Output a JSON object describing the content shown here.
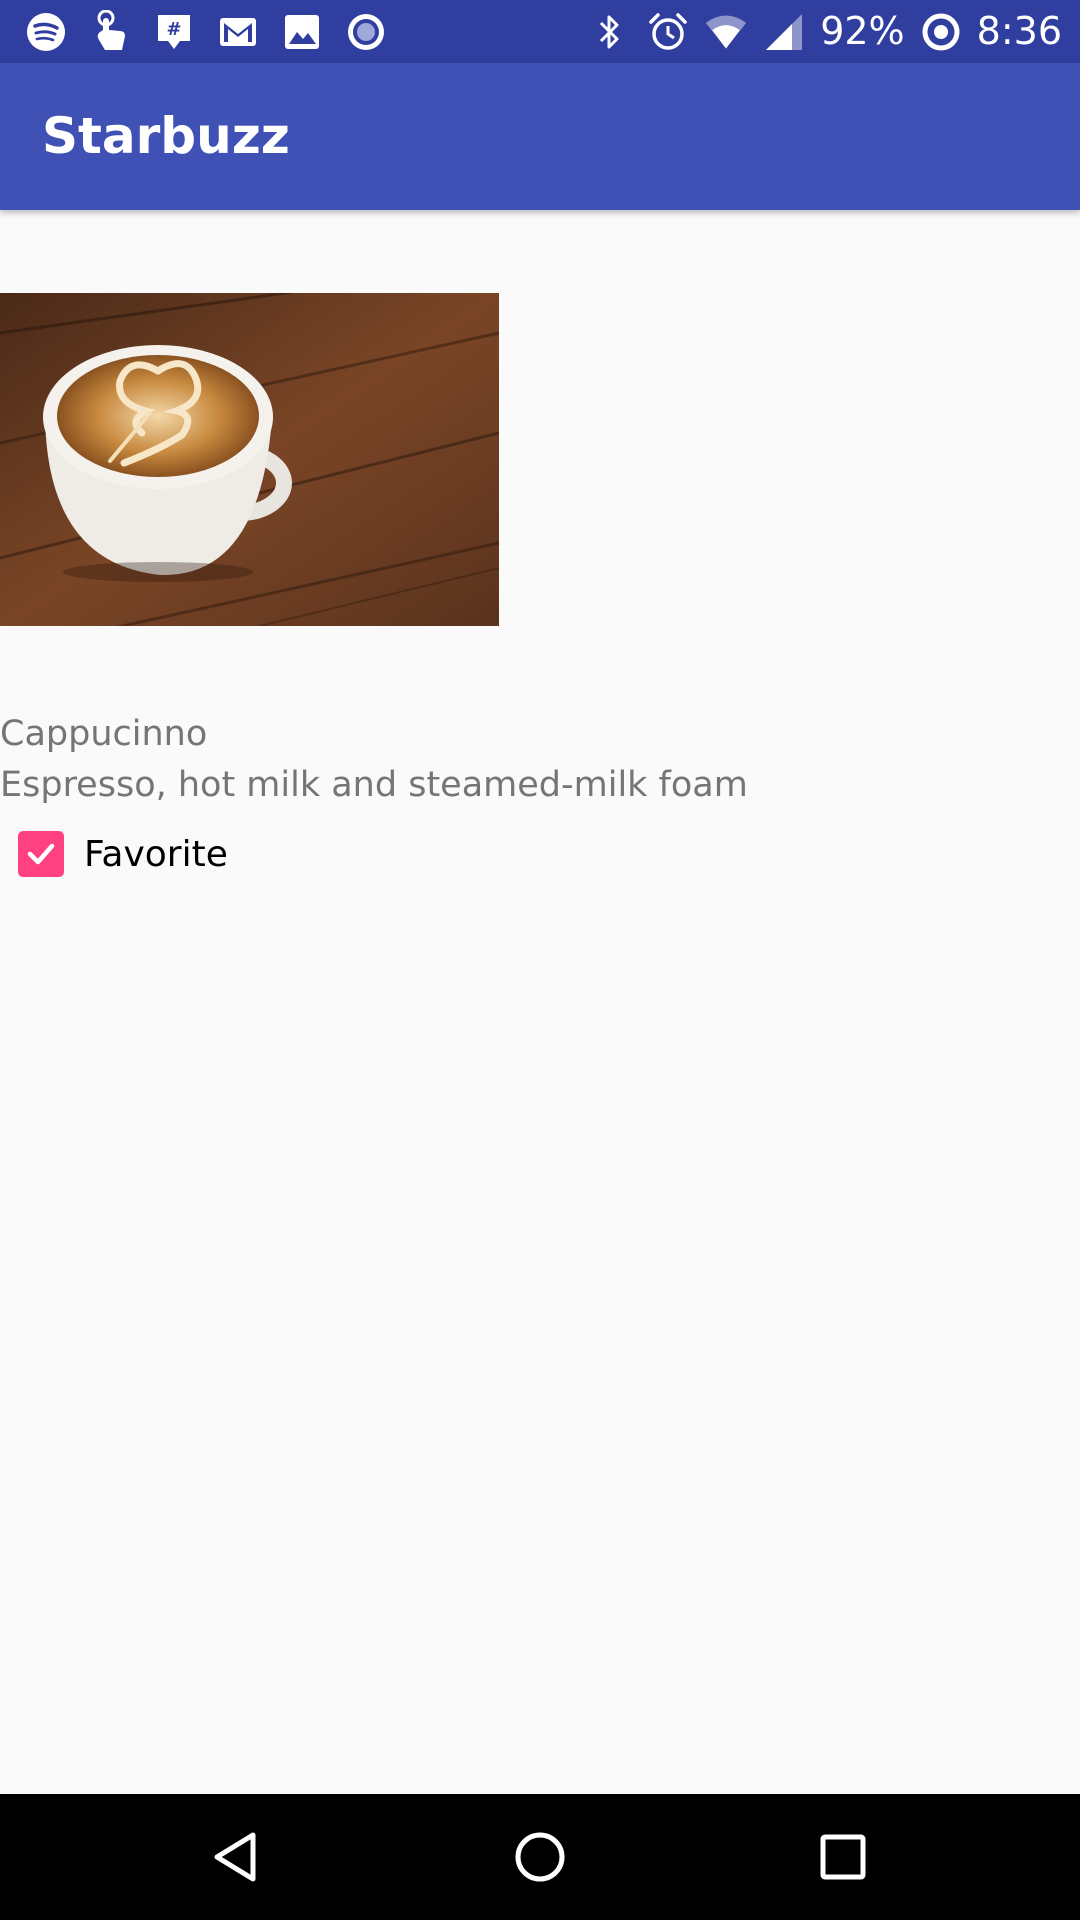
{
  "status_bar": {
    "left_icons": [
      "spotify-icon",
      "touch-icon",
      "slack-icon",
      "gmail-icon",
      "gallery-icon",
      "record-icon"
    ],
    "right_icons": [
      "bluetooth-icon",
      "alarm-icon",
      "wifi-icon",
      "cell-signal-icon",
      "battery-icon"
    ],
    "battery": "92%",
    "time": "8:36",
    "color": "#303f9f"
  },
  "app_bar": {
    "title": "Starbuzz",
    "color": "#3f51b5"
  },
  "drink": {
    "image_icon": "cappuccino-photo",
    "name": "Cappucinno",
    "description": "Espresso, hot milk and steamed-milk foam"
  },
  "favorite": {
    "label": "Favorite",
    "checked": true,
    "color": "#ff4081"
  },
  "nav_bar": {
    "buttons": [
      "back-icon",
      "home-icon",
      "recents-icon"
    ]
  }
}
